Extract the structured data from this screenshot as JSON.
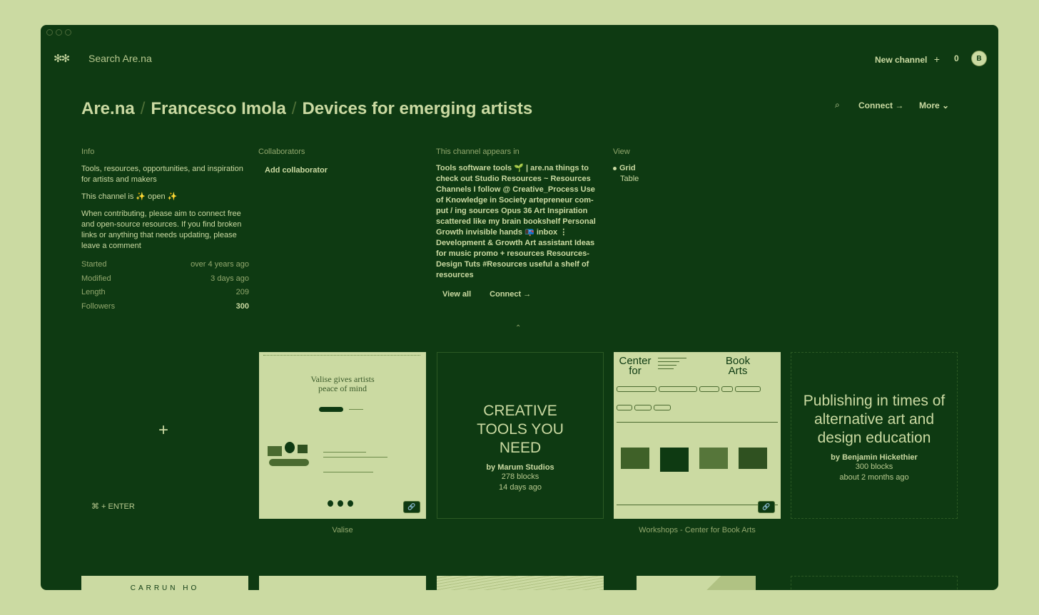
{
  "topbar": {
    "logo": "✻✻",
    "search_placeholder": "Search Are.na",
    "new_channel": "New channel",
    "plus": "+",
    "count": "0",
    "avatar": "B"
  },
  "breadcrumb": {
    "root": "Are.na",
    "user": "Francesco Imola",
    "channel": "Devices for emerging artists",
    "sep": "/"
  },
  "toolbar": {
    "search_icon": "⌕",
    "connect": "Connect →",
    "more": "More ⌄"
  },
  "info": {
    "label": "Info",
    "description": "Tools, resources, opportunities, and inspiration for artists and makers",
    "open_line": "This channel is ✨ open ✨",
    "contrib": "When contributing, please aim to connect free and open-source resources. If you find broken links or anything that needs updating, please leave a comment",
    "meta": [
      {
        "k": "Started",
        "v": "over 4 years ago"
      },
      {
        "k": "Modified",
        "v": "3 days ago"
      },
      {
        "k": "Length",
        "v": "209"
      },
      {
        "k": "Followers",
        "v": "300"
      }
    ]
  },
  "collaborators": {
    "label": "Collaborators",
    "add": "Add collaborator"
  },
  "appears": {
    "label": "This channel appears in",
    "list": "Tools  software tools  🌱 | are.na things to check out  Studio Resources  ~ Resources Channels I follow  @ Creative_Process  Use of Knowledge in Society  artepreneur  com-put / ing  sources  Opus 36  Art Inspiration  scattered like my brain  bookshelf  Personal Growth  invisible hands  📭 inbox ⋮ Development & Growth  Art assistant  Ideas for music promo + resources  Resources- Design Tuts  #Resources  useful  a shelf of resources",
    "view_all": "View all",
    "connect": "Connect →"
  },
  "view": {
    "label": "View",
    "grid": "Grid",
    "table": "Table"
  },
  "collapse_icon": "⌃",
  "add_block": {
    "plus": "+",
    "shortcut": "⌘ + ENTER"
  },
  "cards": [
    {
      "caption": "Valise",
      "headline": "Valise gives artists peace of mind",
      "link_icon": "🔗"
    },
    {
      "title": "CREATIVE TOOLS YOU NEED",
      "by": "by Marum Studios",
      "blocks": "278 blocks",
      "age": "14 days ago"
    },
    {
      "caption": "Workshops - Center for Book Arts",
      "left_title": "Center for",
      "right_title": "Book Arts",
      "link_icon": "🔗"
    },
    {
      "title": "Publishing in times of alternative art and design education",
      "by": "by Benjamin Hickethier",
      "blocks": "300 blocks",
      "age": "about 2 months ago"
    }
  ],
  "bottom_row_text": "CARRUN HQ"
}
